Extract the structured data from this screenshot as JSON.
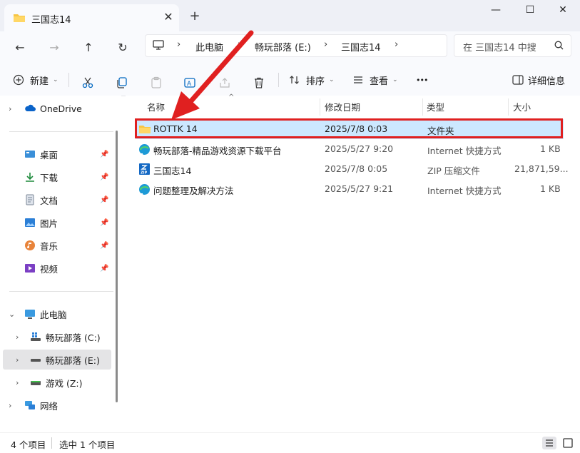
{
  "window": {
    "tab_title": "三国志14",
    "tab_close": "✕",
    "new_tab": "+",
    "minimize": "—",
    "maximize": "☐",
    "close": "✕"
  },
  "address": {
    "crumbs": [
      "此电脑",
      "畅玩部落 (E:)",
      "三国志14"
    ],
    "separator": "›",
    "search_placeholder": "在 三国志14 中搜"
  },
  "toolbar": {
    "new_label": "新建",
    "sort_label": "排序",
    "view_label": "查看",
    "more_label": "•••",
    "details_label": "详细信息"
  },
  "sidebar": {
    "onedrive": "OneDrive",
    "quick": [
      {
        "label": "桌面",
        "icon": "desktop-icon"
      },
      {
        "label": "下载",
        "icon": "download-icon"
      },
      {
        "label": "文档",
        "icon": "document-icon"
      },
      {
        "label": "图片",
        "icon": "pictures-icon"
      },
      {
        "label": "音乐",
        "icon": "music-icon"
      },
      {
        "label": "视频",
        "icon": "video-icon"
      }
    ],
    "this_pc": "此电脑",
    "drives": [
      {
        "label": "畅玩部落 (C:)"
      },
      {
        "label": "畅玩部落 (E:)"
      },
      {
        "label": "游戏 (Z:)"
      }
    ],
    "network": "网络"
  },
  "columns": {
    "name": "名称",
    "date": "修改日期",
    "type": "类型",
    "size": "大小"
  },
  "files": [
    {
      "name": "ROTTK 14",
      "date": "2025/7/8 0:03",
      "type": "文件夹",
      "size": "",
      "icon": "folder-icon"
    },
    {
      "name": "畅玩部落-精品游戏资源下载平台",
      "date": "2025/5/27 9:20",
      "type": "Internet 快捷方式",
      "size": "1 KB",
      "icon": "internet-shortcut-icon"
    },
    {
      "name": "三国志14",
      "date": "2025/7/8 0:05",
      "type": "ZIP 压缩文件",
      "size": "21,871,59...",
      "icon": "zip-icon"
    },
    {
      "name": "问题整理及解决方法",
      "date": "2025/5/27 9:21",
      "type": "Internet 快捷方式",
      "size": "1 KB",
      "icon": "internet-shortcut-icon"
    }
  ],
  "status": {
    "item_count": "4 个项目",
    "selected": "选中 1 个项目"
  },
  "colors": {
    "accent": "#0067c0",
    "selection": "#cce8ff",
    "annotation": "#e02020"
  }
}
